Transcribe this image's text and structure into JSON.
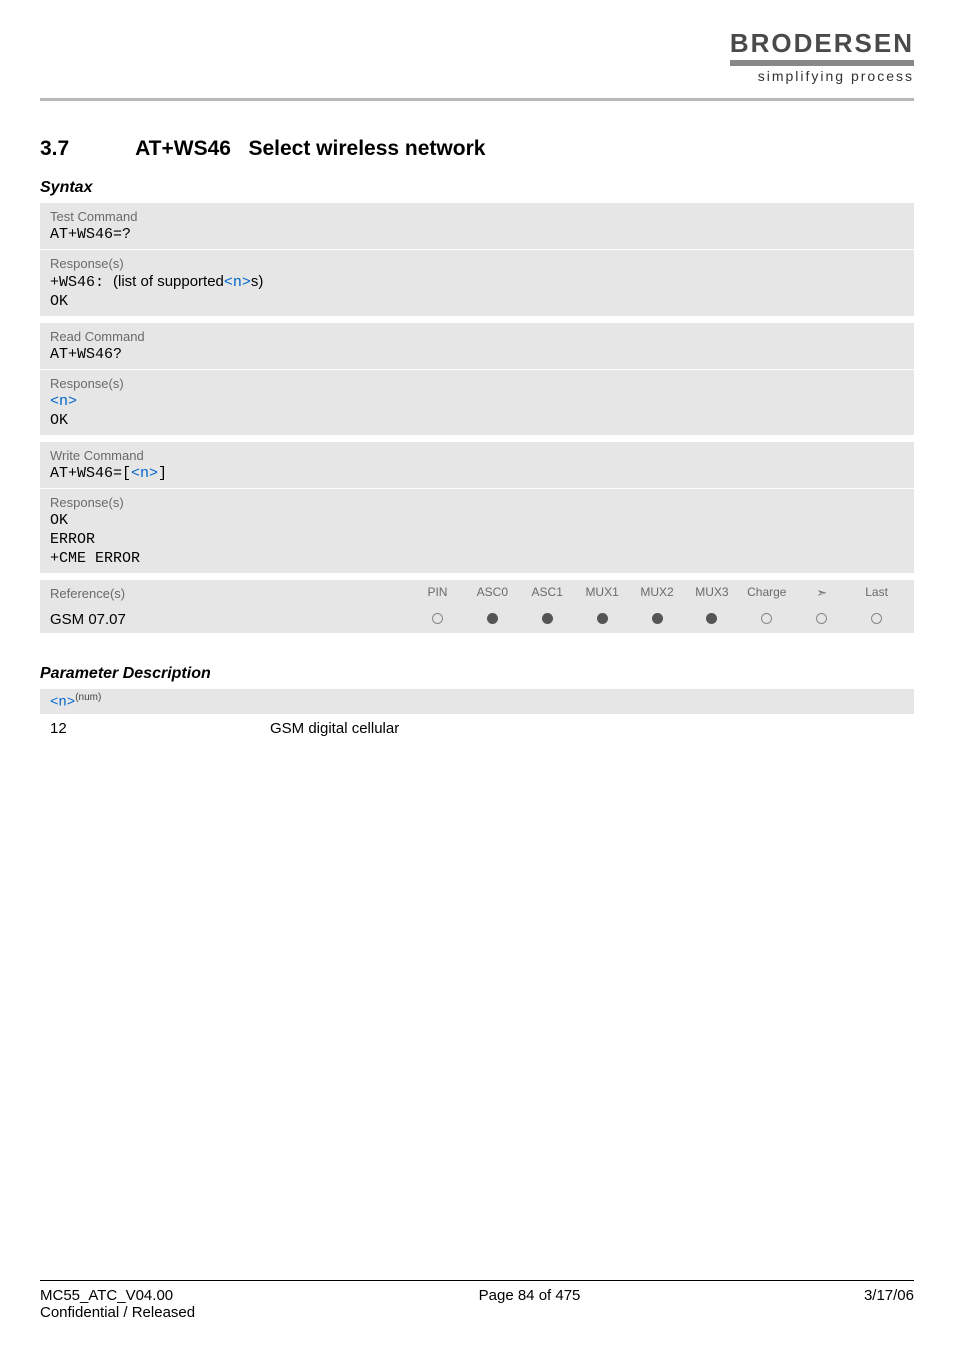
{
  "logo": {
    "name": "BRODERSEN",
    "tagline": "simplifying process"
  },
  "section": {
    "number": "3.7",
    "cmd": "AT+WS46",
    "title": "Select wireless network"
  },
  "syntax_label": "Syntax",
  "blocks": {
    "test": {
      "label": "Test Command",
      "cmd": "AT+WS46=?",
      "resp_label": "Response(s)",
      "resp_prefix": "+WS46: ",
      "resp_text1": "(list of supported",
      "resp_param": "<n>",
      "resp_text2": "s)",
      "ok": "OK"
    },
    "read": {
      "label": "Read Command",
      "cmd": "AT+WS46?",
      "resp_label": "Response(s)",
      "resp_param": "<n>",
      "ok": "OK"
    },
    "write": {
      "label": "Write Command",
      "cmd_prefix": "AT+WS46=",
      "cmd_open": "[",
      "cmd_param": "<n>",
      "cmd_close": "]",
      "resp_label": "Response(s)",
      "ok": "OK",
      "error": "ERROR",
      "cme": "+CME ERROR"
    }
  },
  "reference": {
    "label": "Reference(s)",
    "value": "GSM 07.07",
    "columns": [
      "PIN",
      "ASC0",
      "ASC1",
      "MUX1",
      "MUX2",
      "MUX3",
      "Charge",
      "➣",
      "Last"
    ],
    "states": [
      "empty",
      "filled",
      "filled",
      "filled",
      "filled",
      "filled",
      "empty",
      "empty",
      "empty"
    ]
  },
  "param_desc": {
    "heading": "Parameter Description",
    "tag": "<n>",
    "tag_sup": "(num)",
    "rows": [
      {
        "key": "12",
        "val": "GSM digital cellular"
      }
    ]
  },
  "footer": {
    "left1": "MC55_ATC_V04.00",
    "left2": "Confidential / Released",
    "center": "Page 84 of 475",
    "right": "3/17/06"
  }
}
